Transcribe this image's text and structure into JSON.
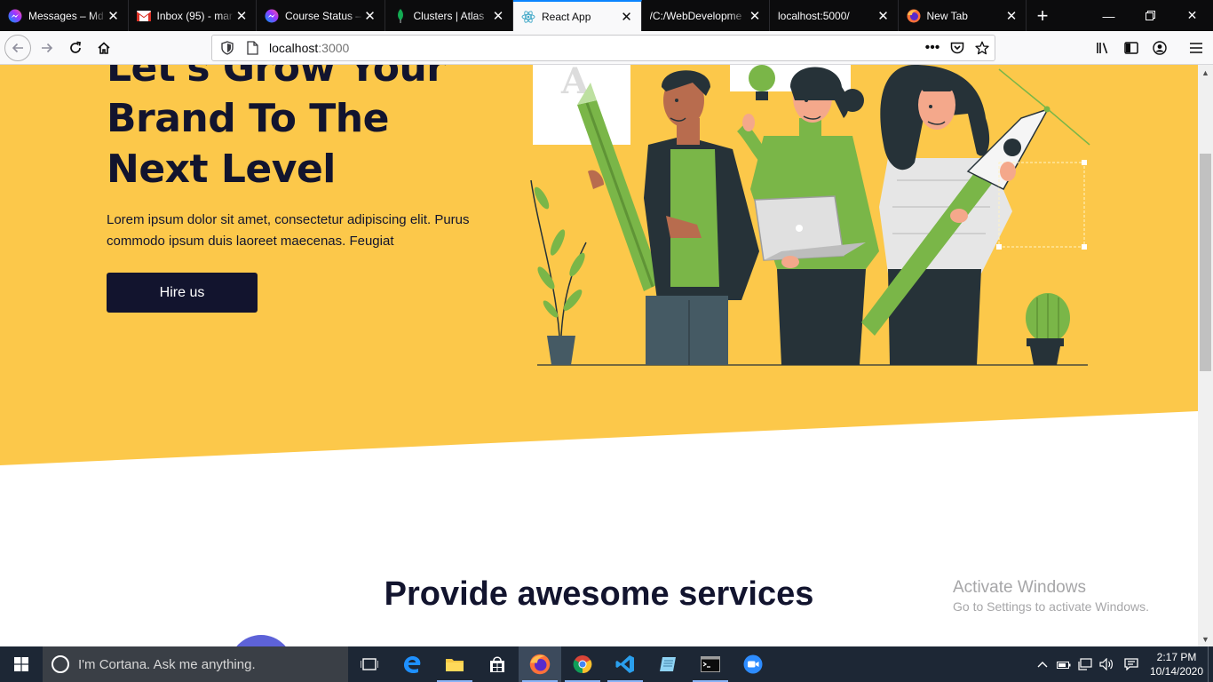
{
  "browser": {
    "tabs": [
      {
        "title": "Messages – Md",
        "icon": "messenger-icon",
        "active": false
      },
      {
        "title": "Inbox (95) - mar",
        "icon": "gmail-icon",
        "active": false
      },
      {
        "title": "Course Status –",
        "icon": "messenger-icon",
        "active": false
      },
      {
        "title": "Clusters | Atlas",
        "icon": "mongodb-leaf-icon",
        "active": false
      },
      {
        "title": "React App",
        "icon": "react-icon",
        "active": true
      },
      {
        "title": "/C:/WebDevelopme",
        "icon": "none",
        "active": false
      },
      {
        "title": "localhost:5000/",
        "icon": "none",
        "active": false
      },
      {
        "title": "New Tab",
        "icon": "firefox-icon",
        "active": false
      }
    ],
    "url_host": "localhost",
    "url_port": ":3000"
  },
  "hero": {
    "title": "Let's Grow Your Brand To The Next Level",
    "description": "Lorem ipsum dolor sit amet, consectetur adipiscing elit. Purus commodo ipsum duis laoreet maecenas. Feugiat",
    "cta": "Hire us",
    "bg_color": "#fcc84a",
    "ink_color": "#12142e"
  },
  "services": {
    "title": "Provide awesome services",
    "circle_color": "#5d62d8"
  },
  "watermark": {
    "line1": "Activate Windows",
    "line2": "Go to Settings to activate Windows."
  },
  "taskbar": {
    "search_placeholder": "I'm Cortana. Ask me anything.",
    "time": "2:17 PM",
    "date": "10/14/2020"
  }
}
